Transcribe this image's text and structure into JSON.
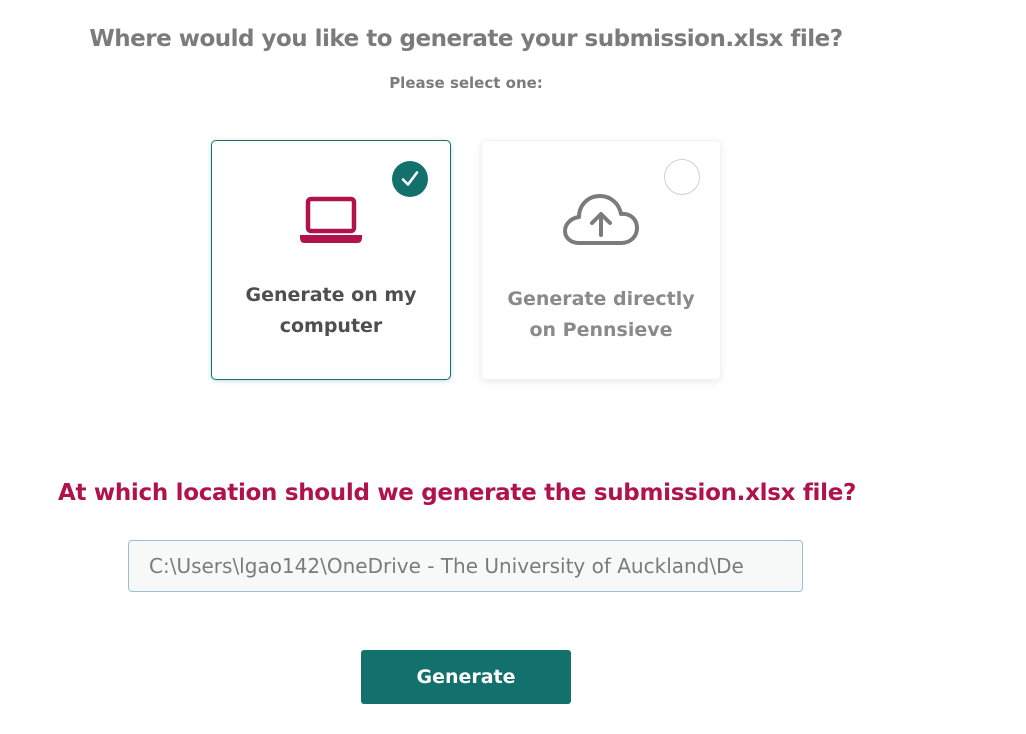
{
  "header": {
    "question": "Where would you like to generate your submission.xlsx file?",
    "instruction": "Please select one:"
  },
  "options": [
    {
      "label": "Generate on my computer",
      "icon": "laptop-icon",
      "selected": true,
      "icon_color": "#b0124a"
    },
    {
      "label": "Generate directly on Pennsieve",
      "icon": "cloud-upload-icon",
      "selected": false,
      "icon_color": "#7b7b7b"
    }
  ],
  "location": {
    "question": "At which location should we generate the submission.xlsx file?",
    "path_value": "C:\\Users\\lgao142\\OneDrive - The University of Auckland\\De"
  },
  "actions": {
    "generate_label": "Generate"
  },
  "colors": {
    "accent": "#13716d",
    "brand_red": "#b0124a",
    "muted_text": "#7b7b7b"
  }
}
